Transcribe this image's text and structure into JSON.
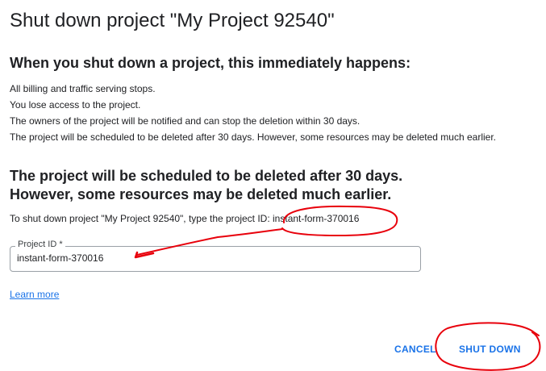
{
  "dialog": {
    "title": "Shut down project \"My Project 92540\"",
    "subhead": "When you shut down a project, this immediately happens:",
    "consequences": [
      "All billing and traffic serving stops.",
      "You lose access to the project.",
      "The owners of the project will be notified and can stop the deletion within 30 days.",
      "The project will be scheduled to be deleted after 30 days. However, some resources may be deleted much earlier."
    ],
    "warning_line1": "The project will be scheduled to be deleted after 30 days.",
    "warning_line2": "However, some resources may be deleted much earlier.",
    "instruction": "To shut down project \"My Project 92540\", type the project ID: instant-form-370016",
    "field": {
      "label": "Project ID *",
      "value": "instant-form-370016"
    },
    "learn_more": "Learn more",
    "cancel_label": "CANCEL",
    "shutdown_label": "SHUT DOWN"
  },
  "colors": {
    "accent": "#1a73e8",
    "text": "#202124",
    "annotation": "#e8000b"
  }
}
